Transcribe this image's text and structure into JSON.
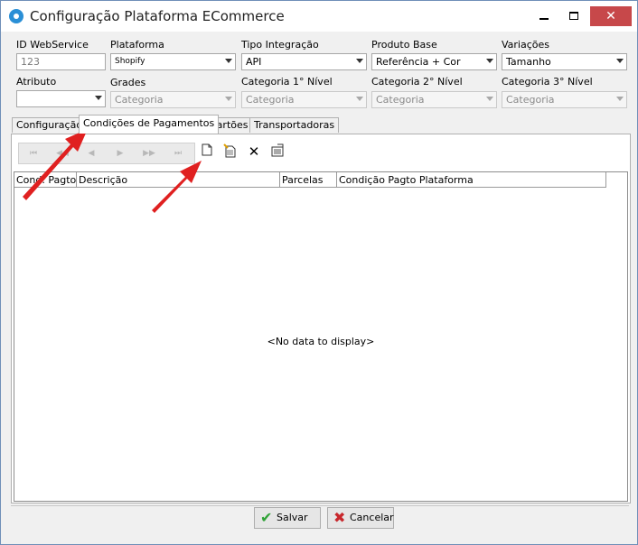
{
  "window": {
    "title": "Configuração Plataforma ECommerce"
  },
  "fields": {
    "id_webservice": {
      "label": "ID WebService",
      "value": "123"
    },
    "plataforma": {
      "label": "Plataforma",
      "value": "Shopify"
    },
    "tipo_integracao": {
      "label": "Tipo Integração",
      "value": "API"
    },
    "produto_base": {
      "label": "Produto Base",
      "value": "Referência + Cor"
    },
    "variacoes": {
      "label": "Variações",
      "value": "Tamanho"
    },
    "atributo": {
      "label": "Atributo",
      "value": ""
    },
    "grades": {
      "label": "Grades",
      "value": "Categoria"
    },
    "categoria1": {
      "label": "Categoria 1° Nível",
      "value": "Categoria"
    },
    "categoria2": {
      "label": "Categoria 2° Nível",
      "value": "Categoria"
    },
    "categoria3": {
      "label": "Categoria 3° Nível",
      "value": "Categoria"
    }
  },
  "tabs": [
    "Configuração",
    "Condições de Pagamentos",
    "Cartões",
    "Transportadoras"
  ],
  "grid": {
    "columns": [
      "Cond. Pagto",
      "Descrição",
      "Parcelas",
      "Condição Pagto Plataforma"
    ],
    "empty_text": "<No data to display>"
  },
  "buttons": {
    "save": "Salvar",
    "cancel": "Cancelar"
  },
  "colors": {
    "close_button": "#c7484a",
    "annotation_arrow": "#e02020",
    "save_icon": "#2fa236",
    "cancel_icon": "#c8282d"
  }
}
